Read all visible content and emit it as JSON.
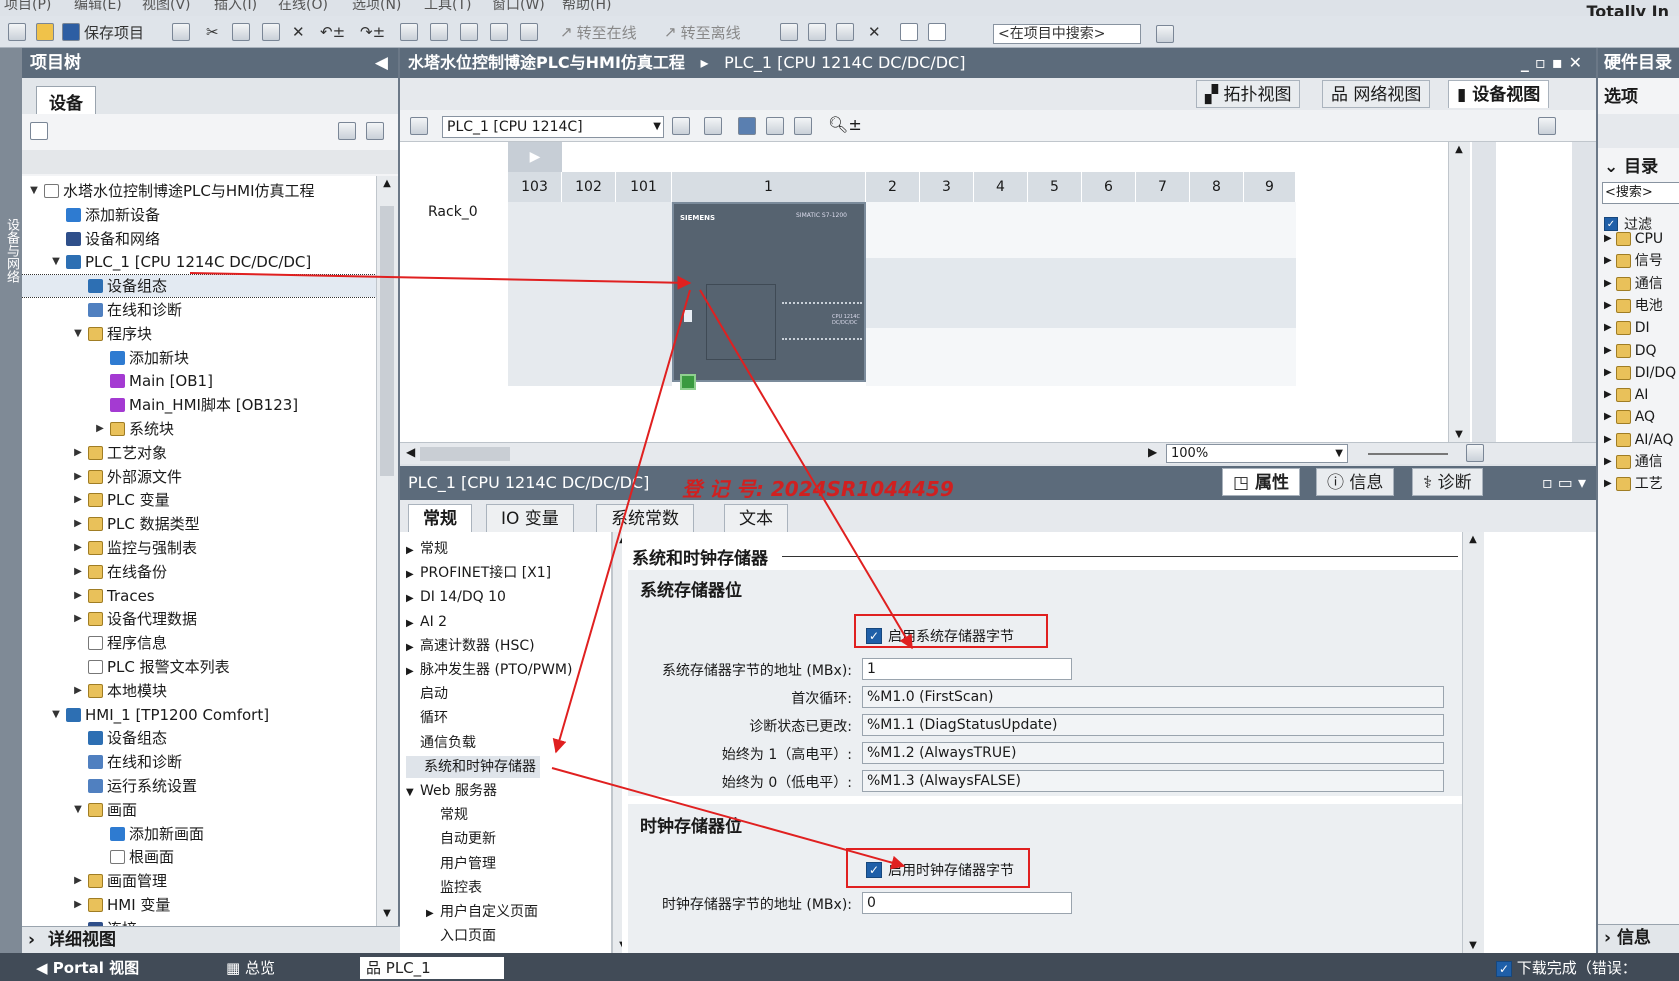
{
  "menu": [
    "项目(P)",
    "编辑(E)",
    "视图(V)",
    "插入(I)",
    "在线(O)",
    "选项(N)",
    "工具(T)",
    "窗口(W)",
    "帮助(H)"
  ],
  "brand": "Totally In",
  "toolbar": {
    "save_label": "保存项目",
    "go_online": "转至在线",
    "go_offline": "转至离线",
    "search_placeholder": "<在项目中搜索>"
  },
  "sidestrip_label": "设备与网络",
  "tree": {
    "header": "项目树",
    "tab": "设备",
    "detail_view": "详细视图",
    "items": [
      {
        "label": "水塔水位控制博途PLC与HMI仿真工程",
        "indent": 0,
        "arrow": "▼",
        "icon": "doc"
      },
      {
        "label": "添加新设备",
        "indent": 1,
        "arrow": "",
        "icon": "add"
      },
      {
        "label": "设备和网络",
        "indent": 1,
        "arrow": "",
        "icon": "net"
      },
      {
        "label": "PLC_1 [CPU 1214C DC/DC/DC]",
        "indent": 1,
        "arrow": "▼",
        "icon": "plc"
      },
      {
        "label": "设备组态",
        "indent": 2,
        "arrow": "",
        "icon": "plc",
        "selected": true
      },
      {
        "label": "在线和诊断",
        "indent": 2,
        "arrow": "",
        "icon": "diag"
      },
      {
        "label": "程序块",
        "indent": 2,
        "arrow": "▼",
        "icon": "fold"
      },
      {
        "label": "添加新块",
        "indent": 3,
        "arrow": "",
        "icon": "add"
      },
      {
        "label": "Main [OB1]",
        "indent": 3,
        "arrow": "",
        "icon": "blk"
      },
      {
        "label": "Main_HMI脚本 [OB123]",
        "indent": 3,
        "arrow": "",
        "icon": "blk"
      },
      {
        "label": "系统块",
        "indent": 3,
        "arrow": "▶",
        "icon": "fold"
      },
      {
        "label": "工艺对象",
        "indent": 2,
        "arrow": "▶",
        "icon": "fold"
      },
      {
        "label": "外部源文件",
        "indent": 2,
        "arrow": "▶",
        "icon": "fold"
      },
      {
        "label": "PLC 变量",
        "indent": 2,
        "arrow": "▶",
        "icon": "fold"
      },
      {
        "label": "PLC 数据类型",
        "indent": 2,
        "arrow": "▶",
        "icon": "fold"
      },
      {
        "label": "监控与强制表",
        "indent": 2,
        "arrow": "▶",
        "icon": "fold"
      },
      {
        "label": "在线备份",
        "indent": 2,
        "arrow": "▶",
        "icon": "fold"
      },
      {
        "label": "Traces",
        "indent": 2,
        "arrow": "▶",
        "icon": "fold"
      },
      {
        "label": "设备代理数据",
        "indent": 2,
        "arrow": "▶",
        "icon": "fold"
      },
      {
        "label": "程序信息",
        "indent": 2,
        "arrow": "",
        "icon": "doc"
      },
      {
        "label": "PLC 报警文本列表",
        "indent": 2,
        "arrow": "",
        "icon": "doc"
      },
      {
        "label": "本地模块",
        "indent": 2,
        "arrow": "▶",
        "icon": "fold"
      },
      {
        "label": "HMI_1 [TP1200 Comfort]",
        "indent": 1,
        "arrow": "▼",
        "icon": "plc"
      },
      {
        "label": "设备组态",
        "indent": 2,
        "arrow": "",
        "icon": "plc"
      },
      {
        "label": "在线和诊断",
        "indent": 2,
        "arrow": "",
        "icon": "diag"
      },
      {
        "label": "运行系统设置",
        "indent": 2,
        "arrow": "",
        "icon": "diag"
      },
      {
        "label": "画面",
        "indent": 2,
        "arrow": "▼",
        "icon": "fold"
      },
      {
        "label": "添加新画面",
        "indent": 3,
        "arrow": "",
        "icon": "add"
      },
      {
        "label": "根画面",
        "indent": 3,
        "arrow": "",
        "icon": "doc"
      },
      {
        "label": "画面管理",
        "indent": 2,
        "arrow": "▶",
        "icon": "fold"
      },
      {
        "label": "HMI 变量",
        "indent": 2,
        "arrow": "▶",
        "icon": "fold"
      },
      {
        "label": "连接",
        "indent": 2,
        "arrow": "",
        "icon": "net"
      }
    ]
  },
  "editor": {
    "breadcrumb_project": "水塔水位控制博途PLC与HMI仿真工程",
    "breadcrumb_sep": "▸",
    "breadcrumb_device": "PLC_1 [CPU 1214C DC/DC/DC]",
    "views": [
      "拓扑视图",
      "网络视图",
      "设备视图"
    ],
    "device_combo": "PLC_1 [CPU 1214C]",
    "rack_label": "Rack_0",
    "slots": [
      "103",
      "102",
      "101",
      "1",
      "2",
      "3",
      "4",
      "5",
      "6",
      "7",
      "8",
      "9"
    ],
    "zoom": "100%",
    "cpu_brand": "SIEMENS",
    "cpu_series": "SIMATIC S7-1200",
    "cpu_model": "CPU 1214C DC/DC/DC"
  },
  "props": {
    "title": "PLC_1 [CPU 1214C DC/DC/DC]",
    "reg_no": "登 记 号:  2024SR1044459",
    "tabs": [
      "属性",
      "信息",
      "诊断"
    ],
    "subtabs": [
      "常规",
      "IO 变量",
      "系统常数",
      "文本"
    ],
    "nav": [
      {
        "label": "常规",
        "indent": 0,
        "arrow": "▶"
      },
      {
        "label": "PROFINET接口 [X1]",
        "indent": 0,
        "arrow": "▶"
      },
      {
        "label": "DI 14/DQ 10",
        "indent": 0,
        "arrow": "▶"
      },
      {
        "label": "AI 2",
        "indent": 0,
        "arrow": "▶"
      },
      {
        "label": "高速计数器 (HSC)",
        "indent": 0,
        "arrow": "▶"
      },
      {
        "label": "脉冲发生器 (PTO/PWM)",
        "indent": 0,
        "arrow": "▶"
      },
      {
        "label": "启动",
        "indent": 0,
        "arrow": ""
      },
      {
        "label": "循环",
        "indent": 0,
        "arrow": ""
      },
      {
        "label": "通信负载",
        "indent": 0,
        "arrow": ""
      },
      {
        "label": "系统和时钟存储器",
        "indent": 0,
        "arrow": "",
        "selected": true
      },
      {
        "label": "Web 服务器",
        "indent": 0,
        "arrow": "▼"
      },
      {
        "label": "常规",
        "indent": 1,
        "arrow": ""
      },
      {
        "label": "自动更新",
        "indent": 1,
        "arrow": ""
      },
      {
        "label": "用户管理",
        "indent": 1,
        "arrow": ""
      },
      {
        "label": "监控表",
        "indent": 1,
        "arrow": ""
      },
      {
        "label": "用户自定义页面",
        "indent": 1,
        "arrow": "▶"
      },
      {
        "label": "入口页面",
        "indent": 1,
        "arrow": ""
      }
    ],
    "section_title": "系统和时钟存储器",
    "sys_title": "系统存储器位",
    "sys_enable": "启用系统存储器字节",
    "sys_addr_label": "系统存储器字节的地址 (MBx):",
    "sys_addr": "1",
    "sys_rows": [
      {
        "label": "首次循环:",
        "value": "%M1.0 (FirstScan)"
      },
      {
        "label": "诊断状态已更改:",
        "value": "%M1.1 (DiagStatusUpdate)"
      },
      {
        "label": "始终为 1（高电平）:",
        "value": "%M1.2 (AlwaysTRUE)"
      },
      {
        "label": "始终为 0（低电平）:",
        "value": "%M1.3 (AlwaysFALSE)"
      }
    ],
    "clk_title": "时钟存储器位",
    "clk_enable": "启用时钟存储器字节",
    "clk_addr_label": "时钟存储器字节的地址 (MBx):",
    "clk_addr": "0"
  },
  "catalog": {
    "header": "硬件目录",
    "options": "选项",
    "section": "目录",
    "search": "<搜索>",
    "filter": "过滤",
    "items": [
      "CPU",
      "信号",
      "通信",
      "电池",
      "DI",
      "DQ",
      "DI/DQ",
      "AI",
      "AQ",
      "AI/AQ",
      "通信",
      "工艺"
    ],
    "info": "信息"
  },
  "status": {
    "portal": "Portal 视图",
    "overview": "总览",
    "plc": "PLC_1",
    "message": "下载完成（错误："
  }
}
